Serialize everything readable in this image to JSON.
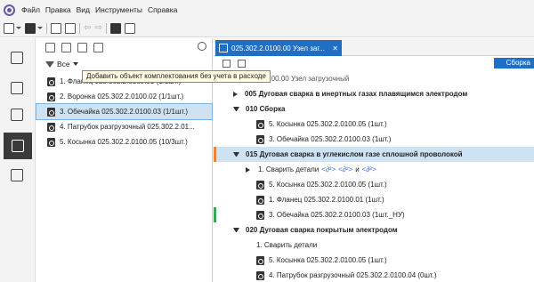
{
  "menu": {
    "items": [
      "Файл",
      "Правка",
      "Вид",
      "Инструменты",
      "Справка"
    ]
  },
  "left_panel": {
    "filter_label": "Все",
    "tooltip": "Добавить объект комплектования без учета в расходе",
    "items": [
      {
        "label": "1. Фланец 025.302.2.0100.01 (1/1шт.)",
        "selected": false
      },
      {
        "label": "2. Воронка 025.302.2.0100.02 (1/1шт.)",
        "selected": false
      },
      {
        "label": "3. Обечайка 025.302.2.0100.03 (1/1шт.)",
        "selected": true
      },
      {
        "label": "4. Патрубок разгрузочный 025.302.2.01...",
        "selected": false
      },
      {
        "label": "5. Косынка 025.302.2.0100.05 (10/3шт.)",
        "selected": false
      }
    ]
  },
  "tab": {
    "label": "025.302.2.0100.00 Узел заг...",
    "close": "✕"
  },
  "right_toolbar": {
    "button_label": "Сборка"
  },
  "tree": {
    "root": "025.302.2.0100.00 Узел загрузочный",
    "rows": [
      {
        "text": "005 Дуговая сварка в инертных газах плавящимся электродом",
        "bold": true
      },
      {
        "text": "010 Сборка",
        "bold": true
      },
      {
        "text": "5. Косынка 025.302.2.0100.05 (1шт.)",
        "bold": false
      },
      {
        "text": "3. Обечайка 025.302.2.0100.03 (1шт.)",
        "bold": false
      },
      {
        "text": "015 Дуговая сварка в углекислом газе сплошной проволокой",
        "bold": true
      },
      {
        "text": "1. Сварить детали",
        "bold": false,
        "suffix_a": "<∂²>",
        "suffix_b": "<∂²>",
        "suffix_and": "и",
        "suffix_c": "<∂²>"
      },
      {
        "text": "5. Косынка 025.302.2.0100.05 (1шт.)",
        "bold": false
      },
      {
        "text": "1. Фланец 025.302.2.0100.01 (1шт.)",
        "bold": false
      },
      {
        "text": "3. Обечайка 025.302.2.0100.03 (1шт._НУ)",
        "bold": false
      },
      {
        "text": "020 Дуговая сварка покрытым электродом",
        "bold": true
      },
      {
        "text": "1. Сварить детали",
        "bold": false
      },
      {
        "text": "5. Косынка 025.302.2.0100.05 (1шт.)",
        "bold": false
      },
      {
        "text": "4. Патрубок разгрузочный 025.302.2.0100.04 (0шт.)",
        "bold": false
      }
    ]
  },
  "colors": {
    "accent": "#1f6fc6",
    "selection": "#cde3f4",
    "orange_marker": "#e8833a",
    "green_marker": "#3aa655"
  }
}
